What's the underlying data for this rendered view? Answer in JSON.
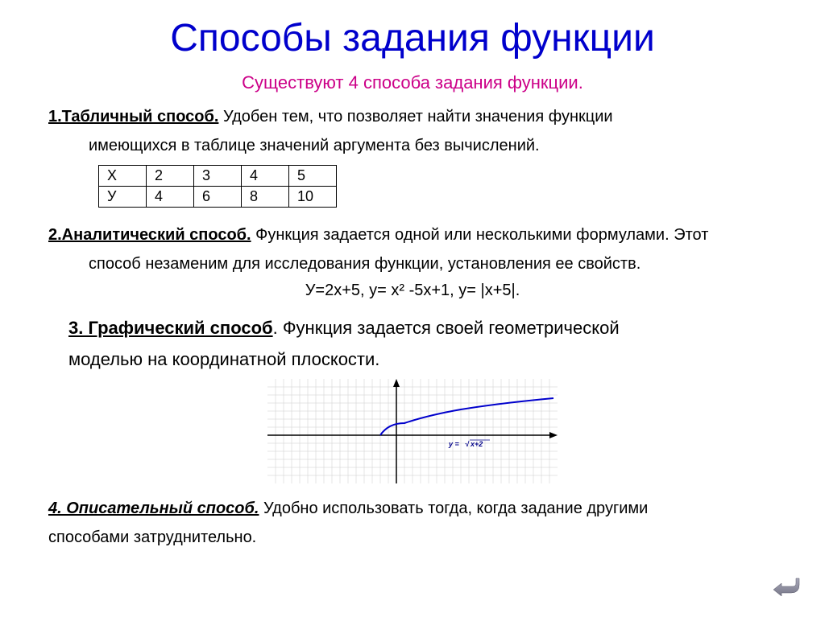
{
  "title": "Способы задания функции",
  "subtitle": "Существуют 4 способа задания функции.",
  "method1": {
    "heading": "1.Табличный способ.",
    "text_part1": " Удобен тем, что позволяет найти значения функции",
    "text_part2": "имеющихся в таблице значений аргумента без вычислений."
  },
  "table": {
    "row1": [
      "Х",
      "2",
      "3",
      "4",
      "5"
    ],
    "row2": [
      "У",
      "4",
      "6",
      "8",
      "10"
    ]
  },
  "method2": {
    "heading": "2.Аналитический способ.",
    "text_part1": " Функция задается одной или несколькими формулами. Этот",
    "text_part2": "способ незаменим для исследования функции, установления ее свойств.",
    "formulas": "У=2х+5,    у= х² -5х+1,     у= |х+5|."
  },
  "method3": {
    "heading": "3. Графический способ",
    "text_part1": ". Функция задается своей геометрической",
    "text_part2": "моделью на координатной плоскости."
  },
  "graph": {
    "equation": "y = √(x+2)"
  },
  "method4": {
    "heading": "4. Описательный способ.",
    "text_part1": " Удобно использовать тогда, когда задание другими",
    "text_part2": "способами затруднительно."
  }
}
